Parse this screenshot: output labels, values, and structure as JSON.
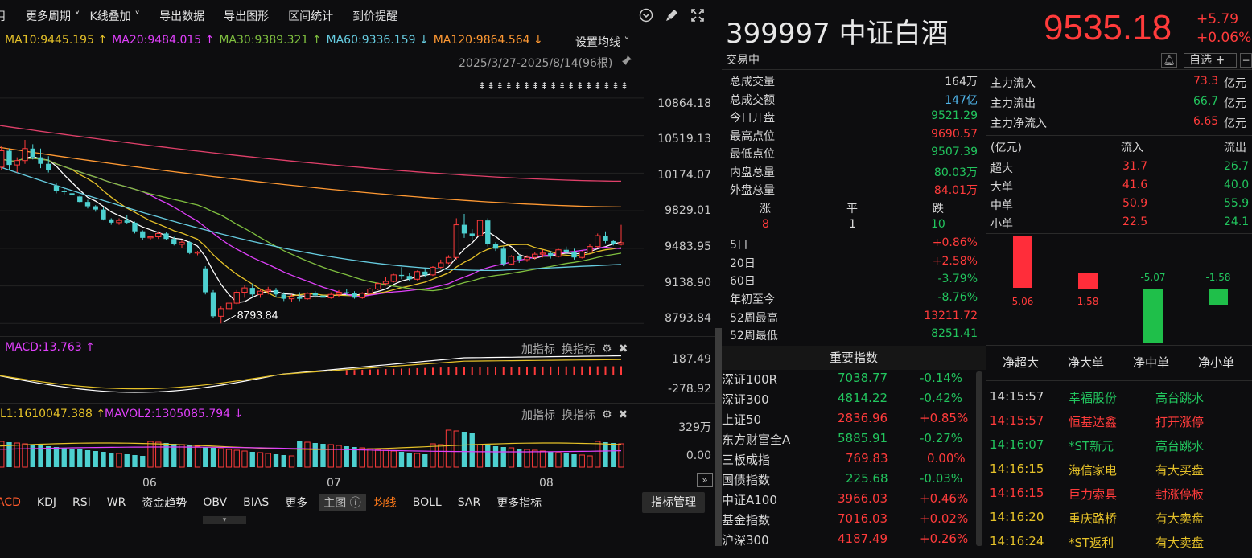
{
  "toolbar": {
    "items": [
      "月",
      "更多周期 ˅",
      "K线叠加 ˅",
      "导出数据",
      "导出图形",
      "区间统计",
      "到价提醒"
    ],
    "icons": [
      "chevron-circle-down-icon",
      "brush-icon",
      "expand-icon"
    ]
  },
  "ma": {
    "items": [
      {
        "text": "MA10:9445.195 ↑",
        "color": "#e6c229"
      },
      {
        "text": "MA20:9484.015 ↑",
        "color": "#e040fb"
      },
      {
        "text": "MA30:9389.321 ↑",
        "color": "#7fbf3f"
      },
      {
        "text": "MA60:9336.159 ↓",
        "color": "#66cce0"
      },
      {
        "text": "MA120:9864.564 ↓",
        "color": "#ff9933"
      }
    ],
    "setting_label": "设置均线 ˅"
  },
  "range_text": "2025/3/27-2025/8/14(96根)",
  "arrow_markers": "⇞⇞⇞⇞⇞⇞⇞⇞⇞⇞⇞⇞⇞⇞⇞⇞⇞",
  "price_axis": [
    "10864.18",
    "10519.13",
    "10174.07",
    "9829.01",
    "9483.95",
    "9138.90",
    "8793.84"
  ],
  "low_marker": "8793.84",
  "macd": {
    "label": "MACD:13.763 ↑",
    "axis": [
      "187.49",
      "-278.92"
    ],
    "tools": [
      "加指标",
      "换指标"
    ]
  },
  "vol": {
    "label1": "L1:1610047.388 ↑",
    "label2": "MAVOL2:1305085.794 ↓",
    "axis": [
      "329万",
      "0.00"
    ],
    "tools": [
      "加指标",
      "换指标"
    ]
  },
  "xaxis": [
    "06",
    "07",
    "08"
  ],
  "bottom_tabs": [
    "ACD",
    "KDJ",
    "RSI",
    "WR",
    "资金趋势",
    "OBV",
    "BIAS",
    "更多",
    "主图 ⓘ",
    "均线",
    "BOLL",
    "SAR",
    "更多指标"
  ],
  "indicator_mgmt": "指标管理",
  "stock": {
    "code_name": "399997 中证白酒",
    "price": "9535.18",
    "change": "+5.79",
    "change_pct": "+0.06%",
    "status": "交易中",
    "watch_label": "自选 +",
    "minus": "−"
  },
  "stats": [
    {
      "label": "总成交量",
      "value": "164万",
      "color": "#d8d8d8"
    },
    {
      "label": "总成交额",
      "value": "147亿",
      "color": "#4fb3e8"
    },
    {
      "label": "今日开盘",
      "value": "9521.29",
      "color": "#22c55e"
    },
    {
      "label": "最高点位",
      "value": "9690.57",
      "color": "#ff3b3b"
    },
    {
      "label": "最低点位",
      "value": "9507.39",
      "color": "#22c55e"
    },
    {
      "label": "内盘总量",
      "value": "80.03万",
      "color": "#22c55e"
    },
    {
      "label": "外盘总量",
      "value": "84.01万",
      "color": "#ff3b3b"
    }
  ],
  "updown": {
    "up_label": "涨",
    "flat_label": "平",
    "down_label": "跌",
    "up": "8",
    "flat": "1",
    "down": "10"
  },
  "perf": [
    {
      "label": "5日",
      "value": "+0.86%",
      "color": "#ff3b3b"
    },
    {
      "label": "20日",
      "value": "+2.58%",
      "color": "#ff3b3b"
    },
    {
      "label": "60日",
      "value": "-3.79%",
      "color": "#22c55e"
    },
    {
      "label": "年初至今",
      "value": "-8.76%",
      "color": "#22c55e"
    },
    {
      "label": "52周最高",
      "value": "13211.72",
      "color": "#ff3b3b"
    },
    {
      "label": "52周最低",
      "value": "8251.41",
      "color": "#22c55e"
    }
  ],
  "mainflow": [
    {
      "label": "主力流入",
      "value": "73.3",
      "unit": "亿元",
      "color": "#ff3b3b"
    },
    {
      "label": "主力流出",
      "value": "66.7",
      "unit": "亿元",
      "color": "#22c55e"
    },
    {
      "label": "主力净流入",
      "value": "6.65",
      "unit": "亿元",
      "color": "#ff3b3b"
    }
  ],
  "flow_table": {
    "header": [
      "(亿元)",
      "流入",
      "流出"
    ],
    "rows": [
      {
        "label": "超大",
        "in": "31.7",
        "out": "26.7"
      },
      {
        "label": "大单",
        "in": "41.6",
        "out": "40.0"
      },
      {
        "label": "中单",
        "in": "50.9",
        "out": "55.9"
      },
      {
        "label": "小单",
        "in": "22.5",
        "out": "24.1"
      }
    ]
  },
  "net_bars": [
    {
      "label": "净超大",
      "value": "5.06",
      "color": "#ff2d3a"
    },
    {
      "label": "净大单",
      "value": "1.58",
      "color": "#ff2d3a"
    },
    {
      "label": "净中单",
      "value": "-5.07",
      "color": "#1fbf4a"
    },
    {
      "label": "净小单",
      "value": "-1.58",
      "color": "#1fbf4a"
    }
  ],
  "indices_header": "重要指数",
  "indices": [
    {
      "name": "深证100R",
      "value": "7038.77",
      "pct": "-0.14%",
      "color": "#22c55e"
    },
    {
      "name": "深证300",
      "value": "4814.22",
      "pct": "-0.42%",
      "color": "#22c55e"
    },
    {
      "name": "上证50",
      "value": "2836.96",
      "pct": "+0.85%",
      "color": "#ff3b3b"
    },
    {
      "name": "东方财富全A",
      "value": "5885.91",
      "pct": "-0.27%",
      "color": "#22c55e"
    },
    {
      "name": "三板成指",
      "value": "769.83",
      "pct": "0.00%",
      "color": "#ff3b3b"
    },
    {
      "name": "国债指数",
      "value": "225.68",
      "pct": "-0.03%",
      "color": "#22c55e"
    },
    {
      "name": "中证A100",
      "value": "3966.03",
      "pct": "+0.46%",
      "color": "#ff3b3b"
    },
    {
      "name": "基金指数",
      "value": "7016.03",
      "pct": "+0.02%",
      "color": "#ff3b3b"
    },
    {
      "name": "沪深300",
      "value": "4187.49",
      "pct": "+0.26%",
      "color": "#ff3b3b"
    }
  ],
  "ticks": [
    {
      "time": "14:15:57",
      "name": "幸福股份",
      "event": "高台跳水",
      "color": "#22c55e"
    },
    {
      "time": "14:15:57",
      "name": "恒基达鑫",
      "event": "打开涨停",
      "color": "#ff3b3b"
    },
    {
      "time": "14:16:07",
      "name": "*ST新元",
      "event": "高台跳水",
      "color": "#22c55e"
    },
    {
      "time": "14:16:15",
      "name": "海信家电",
      "event": "有大买盘",
      "color": "#e6c229"
    },
    {
      "time": "14:16:15",
      "name": "巨力索具",
      "event": "封涨停板",
      "color": "#ff3b3b"
    },
    {
      "time": "14:16:20",
      "name": "重庆路桥",
      "event": "有大卖盘",
      "color": "#e6c229"
    },
    {
      "time": "14:16:24",
      "name": "*ST返利",
      "event": "有大卖盘",
      "color": "#e6c229"
    }
  ],
  "chart_data": {
    "type": "candlestick",
    "symbol": "399997",
    "x_ticks": [
      "06",
      "07",
      "08"
    ],
    "y_ticks": [
      10864.18,
      10519.13,
      10174.07,
      9829.01,
      9483.95,
      9138.9,
      8793.84
    ],
    "ylim": [
      8700,
      11100
    ],
    "low_marker": 8793.84,
    "last_close": 9535.18,
    "candles": [
      [
        10180,
        10240,
        10100,
        10230
      ],
      [
        10230,
        10420,
        10200,
        10380
      ],
      [
        10380,
        10400,
        10200,
        10250
      ],
      [
        10250,
        10320,
        10180,
        10290
      ],
      [
        10290,
        10480,
        10260,
        10400
      ],
      [
        10400,
        10440,
        10300,
        10320
      ],
      [
        10320,
        10400,
        10220,
        10260
      ],
      [
        10260,
        10330,
        10180,
        10200
      ],
      [
        10060,
        10080,
        9990,
        10010
      ],
      [
        10010,
        10040,
        9980,
        10000
      ],
      [
        9990,
        10010,
        9950,
        9970
      ],
      [
        9960,
        9970,
        9900,
        9910
      ],
      [
        9910,
        9930,
        9850,
        9870
      ],
      [
        9870,
        9880,
        9820,
        9840
      ],
      [
        9840,
        9860,
        9740,
        9750
      ],
      [
        9750,
        9760,
        9700,
        9720
      ],
      [
        9720,
        9760,
        9700,
        9740
      ],
      [
        9740,
        9790,
        9710,
        9720
      ],
      [
        9720,
        9730,
        9620,
        9640
      ],
      [
        9640,
        9650,
        9560,
        9580
      ],
      [
        9580,
        9600,
        9560,
        9590
      ],
      [
        9590,
        9640,
        9570,
        9620
      ],
      [
        9620,
        9630,
        9560,
        9570
      ],
      [
        9570,
        9590,
        9510,
        9520
      ],
      [
        9520,
        9560,
        9490,
        9540
      ],
      [
        9540,
        9550,
        9430,
        9440
      ],
      [
        9440,
        9460,
        9420,
        9450
      ],
      [
        9300,
        9320,
        9060,
        9080
      ],
      [
        9080,
        9100,
        8840,
        8860
      ],
      [
        8860,
        8950,
        8794,
        8930
      ],
      [
        8930,
        9020,
        8920,
        8980
      ],
      [
        8980,
        9100,
        8970,
        9080
      ],
      [
        9080,
        9150,
        9030,
        9120
      ],
      [
        9120,
        9160,
        9040,
        9060
      ],
      [
        9060,
        9110,
        9030,
        9090
      ],
      [
        9090,
        9130,
        9060,
        9100
      ],
      [
        9100,
        9120,
        9040,
        9060
      ],
      [
        9060,
        9080,
        9000,
        9020
      ],
      [
        9020,
        9060,
        8990,
        9040
      ],
      [
        9040,
        9080,
        9000,
        9020
      ],
      [
        9020,
        9080,
        9010,
        9070
      ],
      [
        9070,
        9090,
        9030,
        9050
      ],
      [
        9050,
        9070,
        9010,
        9030
      ],
      [
        9030,
        9080,
        9020,
        9060
      ],
      [
        9060,
        9100,
        9040,
        9080
      ],
      [
        9080,
        9110,
        9050,
        9070
      ],
      [
        9070,
        9090,
        9020,
        9030
      ],
      [
        9030,
        9080,
        9020,
        9070
      ],
      [
        9070,
        9120,
        9060,
        9110
      ],
      [
        9110,
        9170,
        9100,
        9160
      ],
      [
        9160,
        9220,
        9140,
        9180
      ],
      [
        9180,
        9250,
        9170,
        9240
      ],
      [
        9240,
        9310,
        9200,
        9230
      ],
      [
        9230,
        9260,
        9180,
        9200
      ],
      [
        9200,
        9280,
        9190,
        9270
      ],
      [
        9270,
        9300,
        9220,
        9240
      ],
      [
        9240,
        9320,
        9230,
        9310
      ],
      [
        9310,
        9380,
        9300,
        9350
      ],
      [
        9350,
        9420,
        9340,
        9400
      ],
      [
        9400,
        9760,
        9380,
        9700
      ],
      [
        9700,
        9800,
        9580,
        9620
      ],
      [
        9620,
        9660,
        9560,
        9600
      ],
      [
        9600,
        9790,
        9590,
        9740
      ],
      [
        9740,
        9760,
        9500,
        9520
      ],
      [
        9520,
        9540,
        9460,
        9480
      ],
      [
        9480,
        9500,
        9320,
        9340
      ],
      [
        9340,
        9420,
        9330,
        9410
      ],
      [
        9410,
        9430,
        9350,
        9380
      ],
      [
        9380,
        9420,
        9360,
        9400
      ],
      [
        9400,
        9450,
        9380,
        9430
      ],
      [
        9430,
        9470,
        9400,
        9440
      ],
      [
        9440,
        9460,
        9390,
        9410
      ],
      [
        9410,
        9480,
        9400,
        9470
      ],
      [
        9470,
        9500,
        9430,
        9450
      ],
      [
        9450,
        9480,
        9380,
        9400
      ],
      [
        9400,
        9460,
        9390,
        9450
      ],
      [
        9450,
        9520,
        9440,
        9500
      ],
      [
        9500,
        9620,
        9490,
        9600
      ],
      [
        9600,
        9640,
        9530,
        9550
      ],
      [
        9550,
        9560,
        9510,
        9520
      ],
      [
        9520,
        9700,
        9510,
        9535
      ]
    ]
  }
}
